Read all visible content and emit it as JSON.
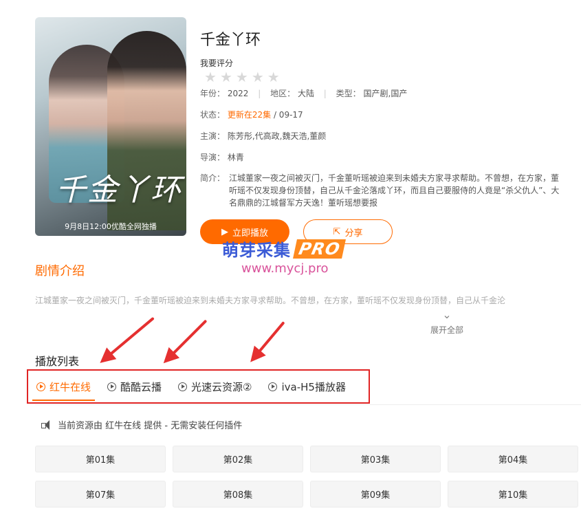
{
  "poster": {
    "title": "千金丫环",
    "caption": "9月8日12:00优酷全网独播"
  },
  "detail": {
    "title": "千金丫环",
    "rate_label": "我要评分",
    "year_label": "年份：",
    "year": "2022",
    "area_label": "地区：",
    "area": "大陆",
    "type_label": "类型：",
    "type": "国产剧,国产",
    "status_label": "状态：",
    "status_highlight": "更新在22集",
    "status_rest": " / 09-17",
    "cast_label": "主演：",
    "cast": "陈芳彤,代高政,魏天浩,董颜",
    "director_label": "导演：",
    "director": "林青",
    "intro_label": "简介：",
    "intro": "江城董家一夜之间被灭门，千金董听瑶被迫来到未婚夫方家寻求帮助。不曾想，在方家，董听瑶不仅发现身份顶替，自己从千金沦落成丫环，而且自己要服侍的人竟是“杀父仇人”、大名鼎鼎的江城督军方天逸！董听瑶想要报",
    "play_label": "立即播放",
    "share_label": "分享"
  },
  "watermark": {
    "main": "萌芽采集",
    "pro": "PRO",
    "url": "www.mycj.pro"
  },
  "plot": {
    "title": "剧情介绍",
    "text": "江城董家一夜之间被灭门，千金董听瑶被迫来到未婚夫方家寻求帮助。不曾想，在方家，董听瑶不仅发现身份顶替，自己从千金沦",
    "expand_label": "展开全部"
  },
  "playlist": {
    "title": "播放列表",
    "tabs": [
      "红牛在线",
      "酷酷云播",
      "光速云资源②",
      "iva-H5播放器"
    ],
    "notice": "当前资源由 红牛在线 提供 - 无需安装任何插件",
    "episodes": [
      "第01集",
      "第02集",
      "第03集",
      "第04集",
      "第07集",
      "第08集",
      "第09集",
      "第10集"
    ]
  },
  "colors": {
    "accent": "#ff6a00",
    "annotation_red": "#e02424"
  }
}
